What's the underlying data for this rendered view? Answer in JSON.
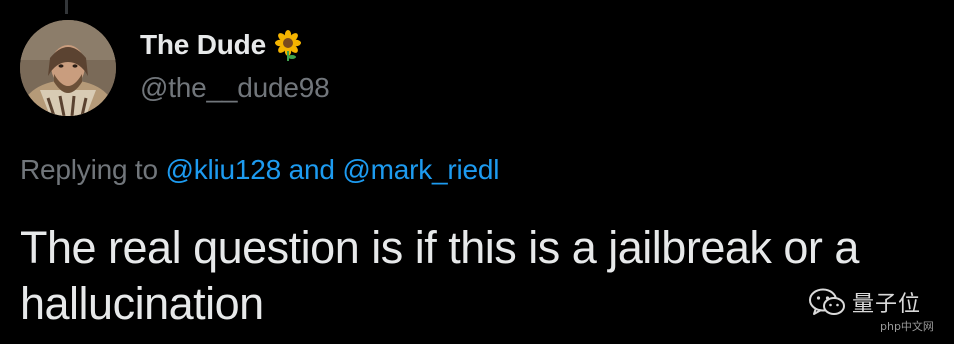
{
  "tweet": {
    "author": {
      "display_name": "The Dude",
      "name_emoji_icon": "sunflower-icon",
      "handle": "@the__dude98",
      "avatar_icon": "avatar-photo"
    },
    "reply_context": {
      "prefix": "Replying to",
      "mention_1": "@kliu128",
      "conjunction": "and",
      "mention_2": "@mark_riedl"
    },
    "text": "The real question is if this is a jailbreak or a hallucination"
  },
  "watermark": {
    "icon": "wechat-icon",
    "label": "量子位",
    "sub_label": "php中文网"
  },
  "colors": {
    "background": "#000000",
    "primary_text": "#e7e9ea",
    "secondary_text": "#71767b",
    "link": "#1d9bf0"
  }
}
